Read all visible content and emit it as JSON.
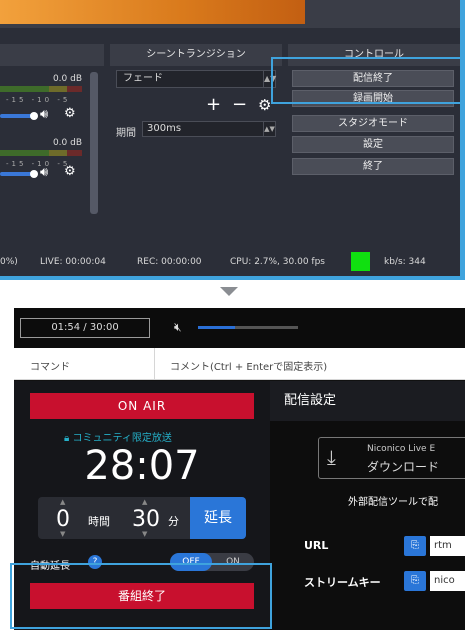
{
  "obs": {
    "headers": {
      "mixer": "",
      "transition": "シーントランジション",
      "controls": "コントロール"
    },
    "mixer": {
      "tracks": [
        {
          "db": "0.0 dB",
          "scale": "-15 -10 -5"
        },
        {
          "db": "0.0 dB",
          "scale": "-15 -10 -5"
        }
      ]
    },
    "transition": {
      "selected": "フェード",
      "add": "+",
      "remove": "−",
      "duration_label": "期間",
      "duration_value": "300ms"
    },
    "controls": {
      "buttons": [
        "配信終了",
        "録画開始",
        "スタジオモード",
        "設定",
        "終了"
      ]
    },
    "status": {
      "zoom": "0%)",
      "live": "LIVE: 00:00:04",
      "rec": "REC: 00:00:00",
      "cpu": "CPU: 2.7%, 30.00 fps",
      "kbs": "kb/s: 344"
    },
    "colors": {
      "highlight": "#3fa3dd",
      "rec_indicator": "#10e010"
    }
  },
  "nico": {
    "time": "01:54 / 30:00",
    "volume_fraction": 0.37,
    "command_label": "コマンド",
    "comment_label": "コメント(Ctrl + Enterで固定表示)",
    "on_air": "ON AIR",
    "community": "コミュニティ限定放送",
    "elapsed": "28:07",
    "extend": {
      "hours": "0",
      "hours_unit": "時間",
      "minutes": "30",
      "minutes_unit": "分",
      "button": "延長"
    },
    "auto_extend": {
      "label": "自動延長",
      "off": "OFF",
      "on": "ON",
      "state": "OFF"
    },
    "end_button": "番組終了",
    "dist": {
      "title": "配信設定",
      "download_line1": "Niconico Live E",
      "download_line2": "ダウンロード",
      "ext_tool": "外部配信ツールで配",
      "url_label": "URL",
      "url_value": "rtm",
      "key_label": "ストリームキー",
      "key_value": "nico"
    },
    "colors": {
      "on_air": "#c8102e",
      "accent": "#2a76d8",
      "community": "#25b0c9"
    }
  }
}
